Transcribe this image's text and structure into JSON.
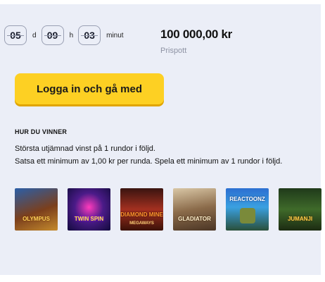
{
  "countdown": {
    "days": "05",
    "days_unit": "d",
    "hours": "09",
    "hours_unit": "h",
    "minutes": "03",
    "minutes_unit": "minut"
  },
  "prize": {
    "value": "100 000,00 kr",
    "label": "Prispott"
  },
  "cta": {
    "label": "Logga in och gå med"
  },
  "how_to_win": {
    "title": "HUR DU VINNER",
    "rules": [
      "Största utjämnad vinst på 1 rundor i följd.",
      "Satsa ett minimum av 1,00 kr per runda. Spela ett minimum av 1 rundor i följd."
    ]
  },
  "games": [
    {
      "title": "OLYMPUS"
    },
    {
      "title": "TWIN SPIN"
    },
    {
      "title": "DIAMOND MINE",
      "subtitle": "MEGAWAYS"
    },
    {
      "title": "GLADIATOR"
    },
    {
      "title": "REACTOONZ"
    },
    {
      "title": "JUMANJI"
    }
  ],
  "colors": {
    "cta_bg": "#fdd023",
    "panel_bg": "#ebeef7",
    "muted_text": "#8d92a3"
  }
}
